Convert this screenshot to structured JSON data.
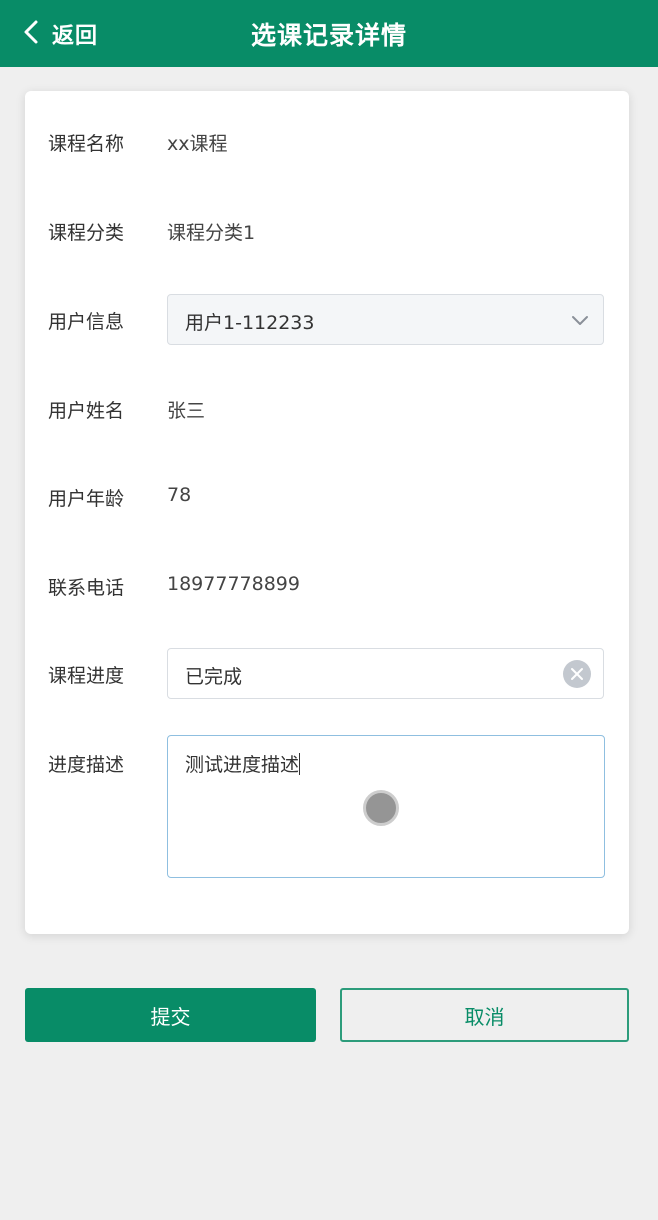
{
  "header": {
    "back_label": "返回",
    "title": "选课记录详情"
  },
  "form": {
    "course_name": {
      "label": "课程名称",
      "value": "xx课程"
    },
    "course_category": {
      "label": "课程分类",
      "value": "课程分类1"
    },
    "user_info": {
      "label": "用户信息",
      "value": "用户1-112233"
    },
    "user_name": {
      "label": "用户姓名",
      "value": "张三"
    },
    "user_age": {
      "label": "用户年龄",
      "value": "78"
    },
    "phone": {
      "label": "联系电话",
      "value": "18977778899"
    },
    "progress": {
      "label": "课程进度",
      "value": "已完成"
    },
    "progress_desc": {
      "label": "进度描述",
      "value": "测试进度描述"
    }
  },
  "actions": {
    "submit_label": "提交",
    "cancel_label": "取消"
  },
  "colors": {
    "primary": "#088c67",
    "background": "#efefef"
  },
  "icons": {
    "back": "chevron-left-icon",
    "select": "chevron-down-icon",
    "clear": "clear-icon"
  }
}
